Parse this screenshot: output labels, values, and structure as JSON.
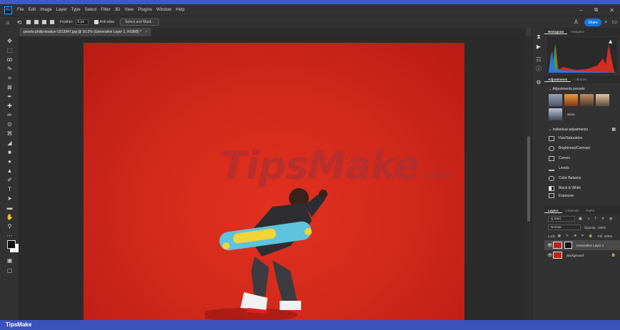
{
  "app": {
    "logo": "Ps"
  },
  "menu": [
    "File",
    "Edit",
    "Image",
    "Layer",
    "Type",
    "Select",
    "Filter",
    "3D",
    "View",
    "Plugins",
    "Window",
    "Help"
  ],
  "window_controls": {
    "minimize": "–",
    "maximize": "⧉",
    "close": "✕"
  },
  "options": {
    "home_icon": "home-icon",
    "lasso_icon": "lasso-icon",
    "feather_label": "Feather:",
    "feather_value": "0 px",
    "antialias_label": "Anti-alias",
    "select_mask_label": "Select and Mask...",
    "share_label": "Share"
  },
  "document": {
    "tab_title": "pexels-philip-boakye-1813947.jpg @ 10.2% (Generative Layer 1, RGB/8) *",
    "close": "×"
  },
  "watermark": {
    "text": "TipsMake",
    "suffix": ".com"
  },
  "panels": {
    "top_tabs": [
      {
        "label": "Histogram",
        "active": true
      },
      {
        "label": "Navigator",
        "active": false
      }
    ],
    "adj_tabs": [
      {
        "label": "Adjustments",
        "active": true
      },
      {
        "label": "Libraries",
        "active": false
      }
    ],
    "presets_header": "Adjustments presets",
    "more_label": "More",
    "individual_header": "Individual adjustments",
    "adjustments": [
      "Hue/Saturation",
      "Brightness/Contrast",
      "Curves",
      "Levels",
      "Color Balance",
      "Black & White",
      "Exposure"
    ],
    "layer_tabs": [
      {
        "label": "Layers",
        "active": true
      },
      {
        "label": "Channels",
        "active": false
      },
      {
        "label": "Paths",
        "active": false
      }
    ],
    "kind_label": "Q Kind",
    "blend_mode": "Normal",
    "opacity_label": "Opacity:",
    "opacity_value": "100%",
    "lock_label": "Lock:",
    "fill_label": "Fill:",
    "fill_value": "100%",
    "layers": [
      {
        "name": "Generative Layer 1",
        "selected": true
      },
      {
        "name": "Background",
        "selected": false
      }
    ]
  },
  "footer": {
    "brand": "TipsMake"
  },
  "colors": {
    "accent": "#1473e6",
    "canvas_red": "#d32a1c",
    "footer_blue": "#3b52bd"
  }
}
